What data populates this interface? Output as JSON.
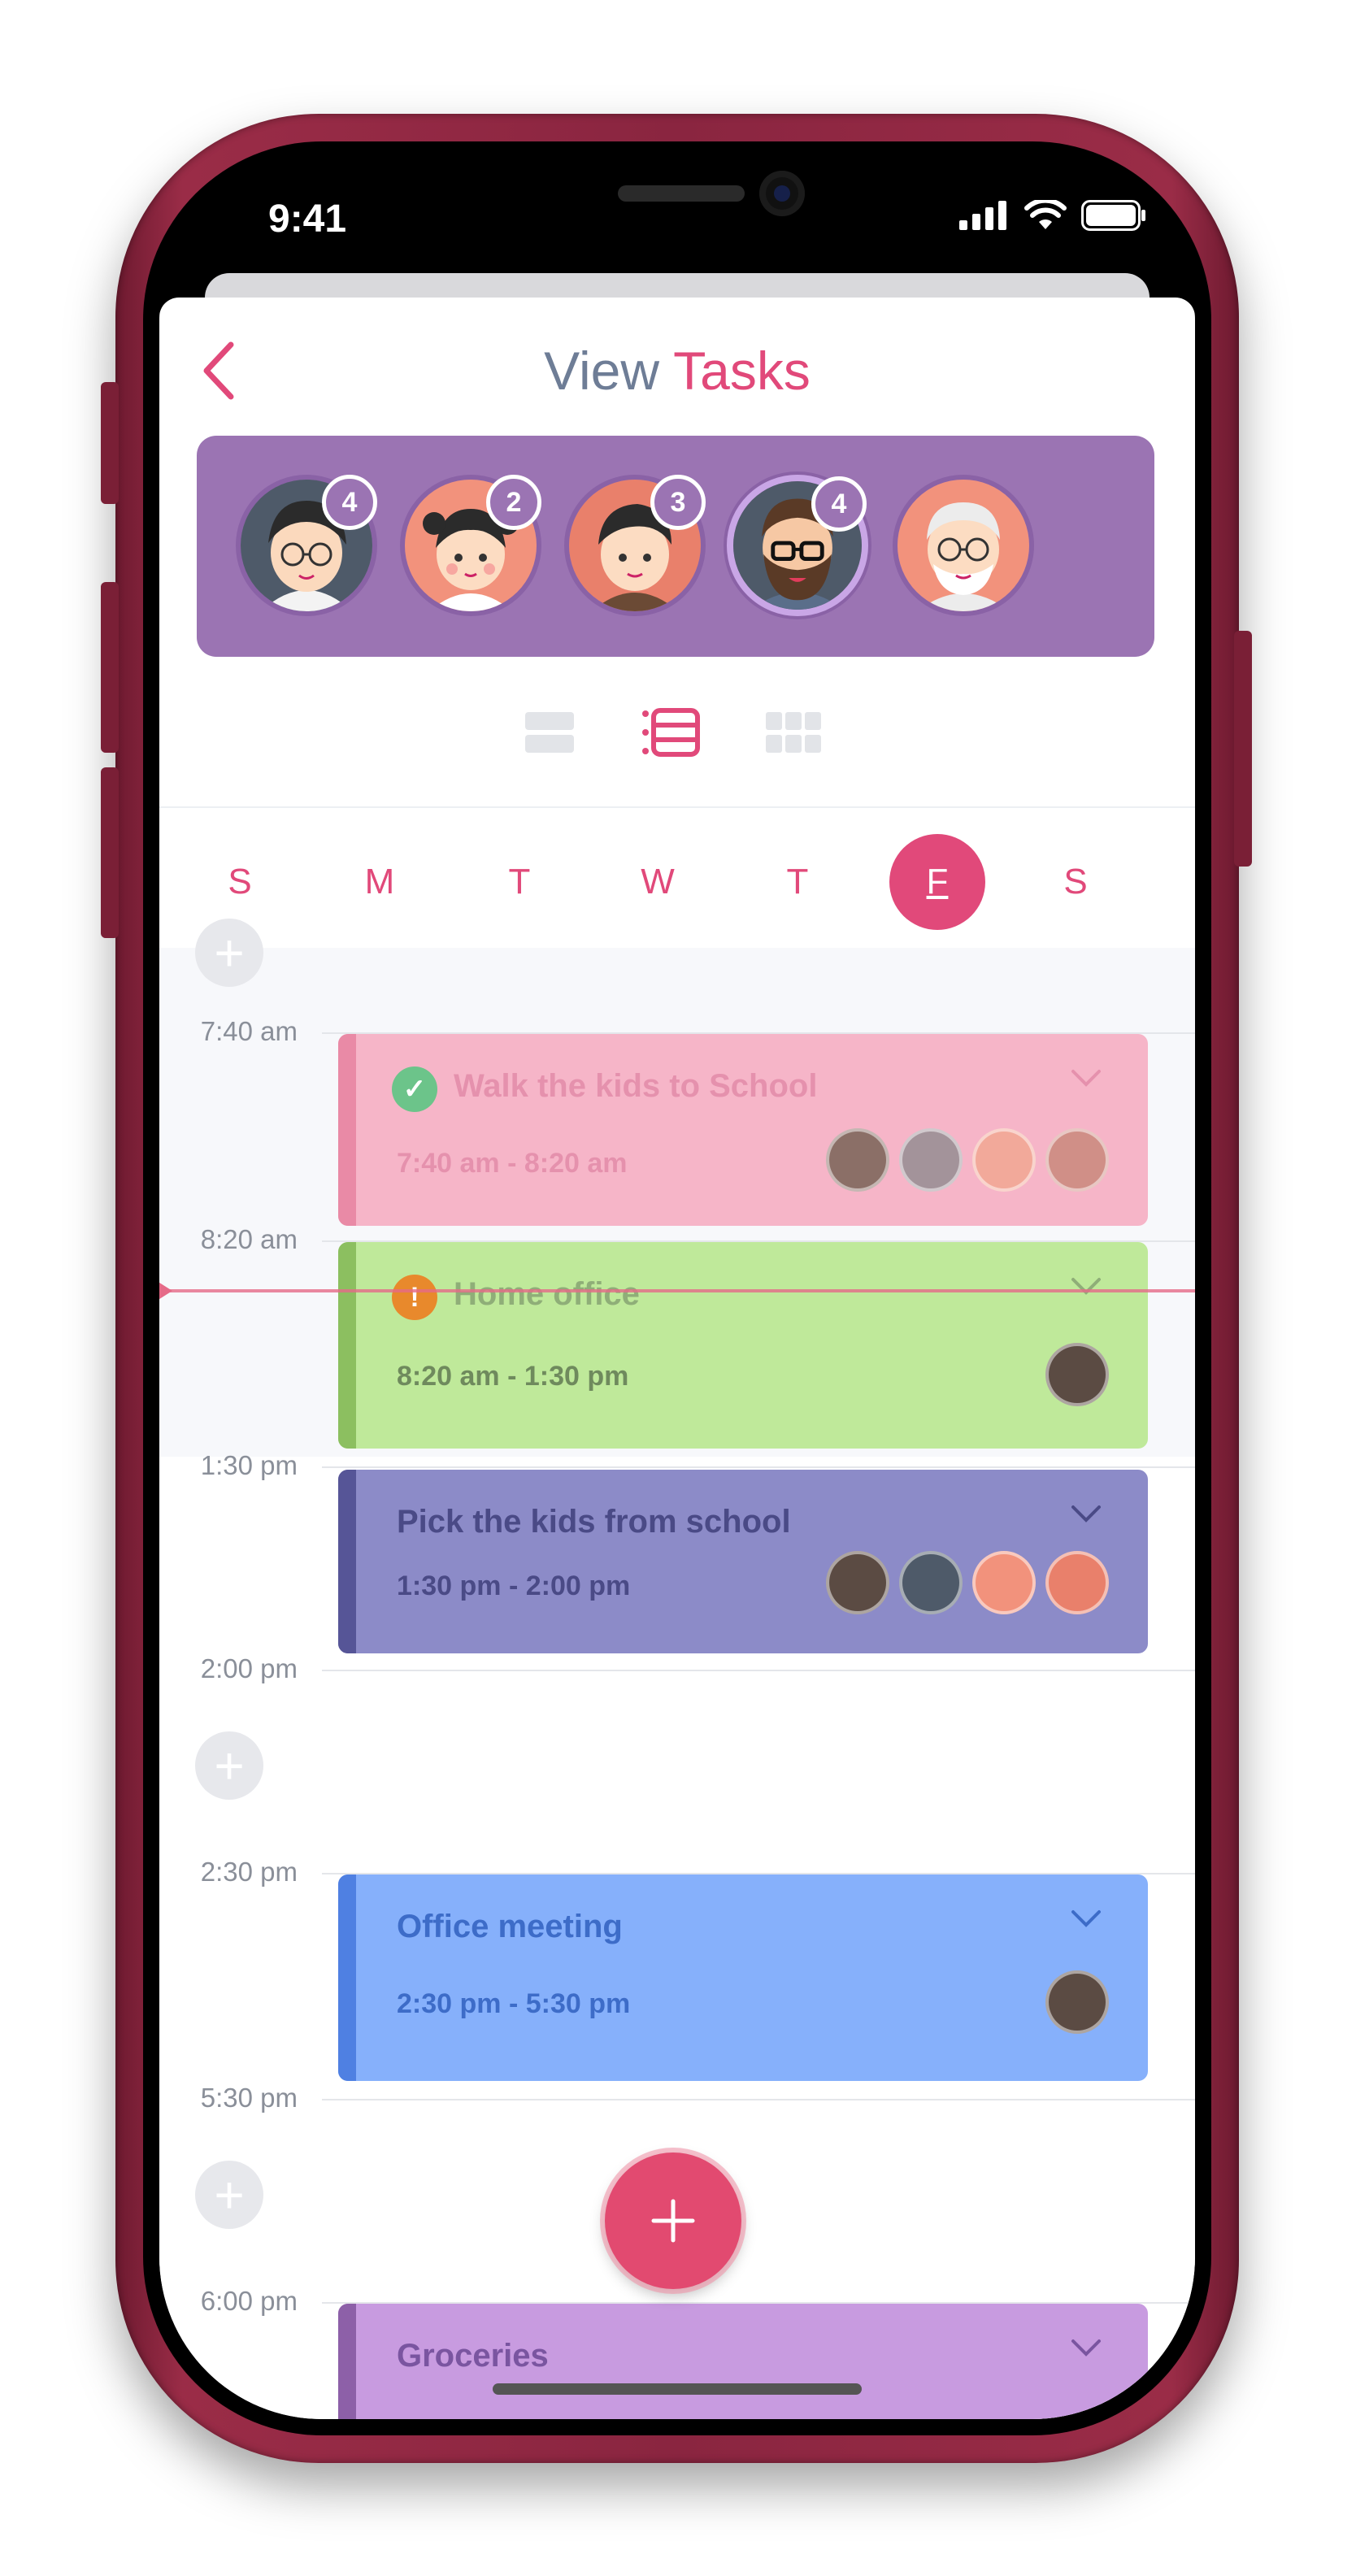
{
  "status_bar": {
    "time": "9:41"
  },
  "header": {
    "title_prefix": "View",
    "title_accent": "Tasks"
  },
  "family": {
    "members": [
      {
        "name": "mom",
        "count": "4"
      },
      {
        "name": "daughter",
        "count": "2"
      },
      {
        "name": "son",
        "count": "3"
      },
      {
        "name": "dad",
        "count": "4",
        "selected": true
      },
      {
        "name": "grandpa",
        "count": ""
      }
    ],
    "accent": "#9b74b3"
  },
  "view_modes": [
    "list",
    "timeline",
    "grid"
  ],
  "weekdays": [
    "S",
    "M",
    "T",
    "W",
    "T",
    "F",
    "S"
  ],
  "weekdays_active": "F",
  "times": [
    "7:40 am",
    "8:20 am",
    "1:30 pm",
    "2:00 pm",
    "2:30 pm",
    "5:30 pm",
    "6:00 pm"
  ],
  "tasks": [
    {
      "title": "Walk the kids to School",
      "range": "7:40 am - 8:20 am",
      "status": "done",
      "color": "#f6b5c8",
      "bar": "#e98aa6",
      "text": "#e591ad"
    },
    {
      "title": "Home office",
      "range": "8:20 am - 1:30 pm",
      "status": "warning",
      "color": "#bfe99a",
      "bar": "#8cbf60",
      "text": "#7f9a6a"
    },
    {
      "title": "Pick the kids from school",
      "range": "1:30 pm - 2:00 pm",
      "status": "",
      "color": "#8c8bc8",
      "bar": "#565597",
      "text": "#4a4a86"
    },
    {
      "title": "Office meeting",
      "range": "2:30 pm - 5:30 pm",
      "status": "",
      "color": "#86b0fb",
      "bar": "#4f80e2",
      "text": "#3d6cc8"
    },
    {
      "title": "Groceries",
      "range": "",
      "status": "",
      "color": "#c89be0",
      "bar": "#8d60a8",
      "text": "#7a55a0"
    }
  ],
  "icons": {
    "back": "chevron-left-icon",
    "add": "plus-icon",
    "expand": "chevron-down-icon",
    "done": "check-icon",
    "warning": "exclamation-icon"
  }
}
